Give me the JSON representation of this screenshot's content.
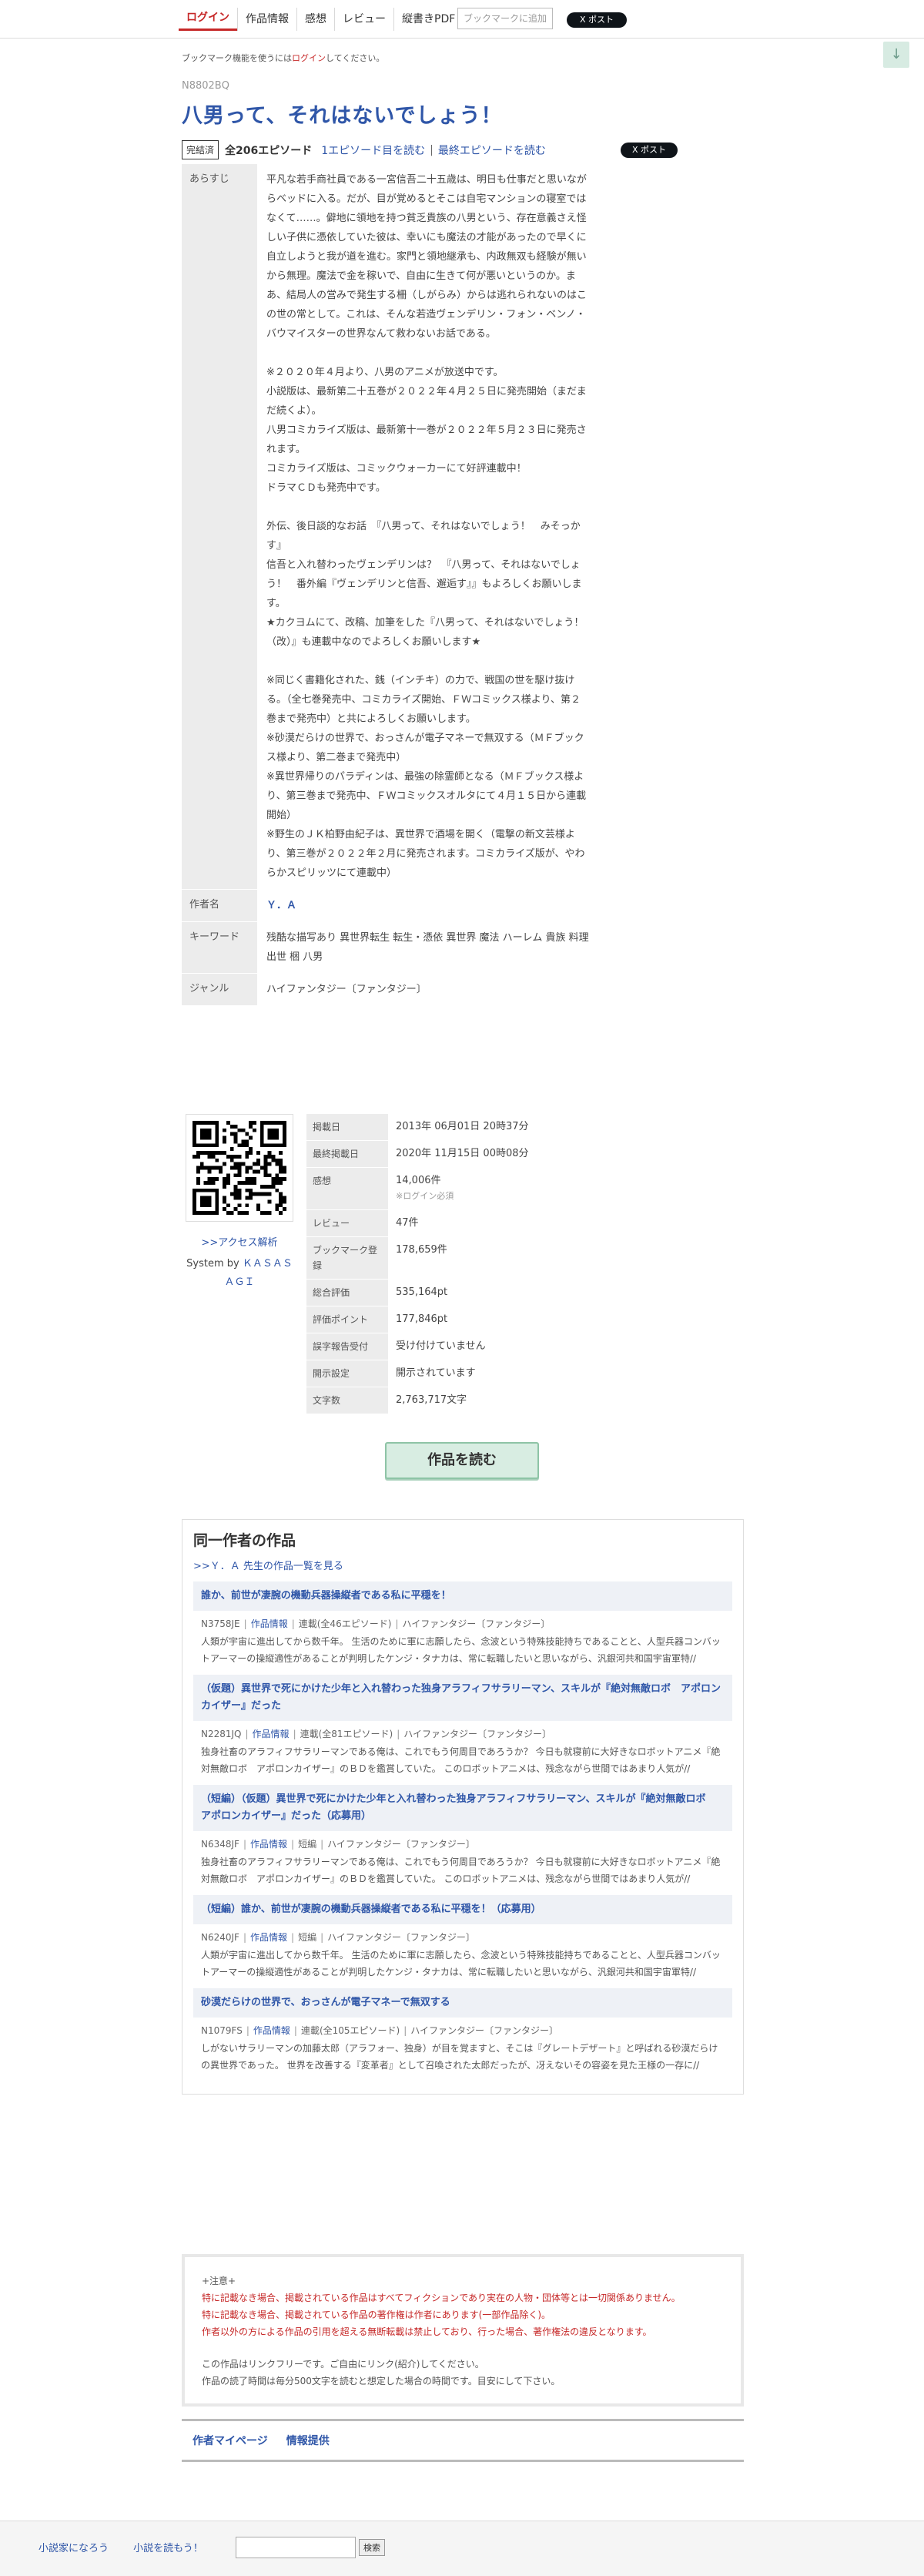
{
  "nav": {
    "items": [
      "ログイン",
      "作品情報",
      "感想",
      "レビュー",
      "縦書きPDF"
    ],
    "bookmark_button": "ブックマークに追加",
    "x_post": "X ポスト"
  },
  "login_note": {
    "prefix": "ブックマーク機能を使うには",
    "link": "ログイン",
    "suffix": "してください。"
  },
  "scroll_icon": "arrow-down-icon",
  "novel": {
    "ncode": "N8802BQ",
    "title": "八男って、それはないでしょう！",
    "status_badge": "完結済",
    "episodes": "全206エピソード",
    "first_episode_link": "1エピソード目を読む",
    "separator": "|",
    "last_episode_link": "最終エピソードを読む",
    "x_post": "X ポスト"
  },
  "info": {
    "synopsis_label": "あらすじ",
    "synopsis_lines": [
      "平凡な若手商社員である一宮信吾二十五歳は、明日も仕事だと思いながらベッドに入る。だが、目が覚めるとそこは自宅マンションの寝室ではなくて……。僻地に領地を持つ貧乏貴族の八男という、存在意義さえ怪しい子供に憑依していた彼は、幸いにも魔法の才能があったので早くに自立しようと我が道を進む。家門と領地継承も、内政無双も経験が無いから無理。魔法で金を稼いで、自由に生きて何が悪いというのか。まあ、結局人の営みで発生する柵（しがらみ）からは逃れられないのはこの世の常として。これは、そんな若造ヴェンデリン・フォン・ベンノ・バウマイスターの世界なんて救わないお話である。",
      "",
      "※２０２０年４月より、八男のアニメが放送中です。",
      "小説版は、最新第二十五巻が２０２２年４月２５日に発売開始（まだまだ続くよ）。",
      "八男コミカライズ版は、最新第十一巻が２０２２年５月２３日に発売されます。",
      "コミカライズ版は、コミックウォーカーにて好評連載中！",
      "ドラマＣＤも発売中です。",
      "",
      "外伝、後日談的なお話　『八男って、それはないでしょう！　みそっかす』",
      "信吾と入れ替わったヴェンデリンは？　『八男って、それはないでしょう！　番外編『ヴェンデリンと信吾、邂逅す』』もよろしくお願いします。",
      "★カクヨムにて、改稿、加筆をした『八男って、それはないでしょう！（改）』も連載中なのでよろしくお願いします★",
      "",
      "※同じく書籍化された、銭（インチキ）の力で、戦国の世を駆け抜ける。（全七巻発売中、コミカライズ開始、ＦＷコミックス様より、第２巻まで発売中）と共によろしくお願いします。",
      "※砂漠だらけの世界で、おっさんが電子マネーで無双する（ＭＦブックス様より、第二巻まで発売中）",
      "※異世界帰りのパラディンは、最強の除霊師となる（ＭＦブックス様より、第三巻まで発売中、ＦＷコミックスオルタにて４月１５日から連載開始）",
      "※野生のＪＫ柏野由紀子は、異世界で酒場を開く（電撃の新文芸様より、第三巻が２０２２年２月に発売されます。コミカライズ版が、やわらかスピリッツにて連載中）"
    ],
    "author_label": "作者名",
    "author": "Ｙ．Ａ",
    "keyword_label": "キーワード",
    "keywords": "残酷な描写あり 異世界転生 転生・憑依 異世界 魔法 ハーレム 貴族 料理 出世 梱 八男",
    "genre_label": "ジャンル",
    "genre": "ハイファンタジー〔ファンタジー〕"
  },
  "qr": {
    "access_link": ">>アクセス解析",
    "system_prefix": "System by ",
    "system_name": "ＫＡＳＡＳＡＧＩ"
  },
  "stats": [
    {
      "label": "掲載日",
      "value": "2013年 06月01日 20時37分"
    },
    {
      "label": "最終掲載日",
      "value": "2020年 11月15日 00時08分"
    },
    {
      "label": "感想",
      "value": "14,006件",
      "note": "※ログイン必須"
    },
    {
      "label": "レビュー",
      "value": "47件"
    },
    {
      "label": "ブックマーク登録",
      "value": "178,659件"
    },
    {
      "label": "総合評価",
      "value": "535,164pt"
    },
    {
      "label": "評価ポイント",
      "value": "177,846pt"
    },
    {
      "label": "誤字報告受付",
      "value": "受け付けていません"
    },
    {
      "label": "開示設定",
      "value": "開示されています"
    },
    {
      "label": "文字数",
      "value": "2,763,717文字"
    }
  ],
  "read_button": "作品を読む",
  "same_author": {
    "heading": "同一作者の作品",
    "all_link": ">>Ｙ．Ａ 先生の作品一覧を見る",
    "works": [
      {
        "title": "誰か、前世が凄腕の機動兵器操縦者である私に平穏を！",
        "ncode": "N3758JE",
        "info_link": "作品情報",
        "type": "連載(全46エピソード)",
        "genre": "ハイファンタジー〔ファンタジー〕",
        "desc": "人類が宇宙に進出してから数千年。 生活のために軍に志願したら、念波という特殊技能持ちであることと、人型兵器コンバットアーマーの操縦適性があることが判明したケンジ・タナカは、常に転職したいと思いながら、汎銀河共和国宇宙軍特//"
      },
      {
        "title": "（仮題）異世界で死にかけた少年と入れ替わった独身アラフィフサラリーマン、スキルが『絶対無敵ロボ　アポロンカイザー』だった",
        "ncode": "N2281JQ",
        "info_link": "作品情報",
        "type": "連載(全81エピソード)",
        "genre": "ハイファンタジー〔ファンタジー〕",
        "desc": "独身社畜のアラフィフサラリーマンである俺は、これでもう何周目であろうか？ 今日も就寝前に大好きなロボットアニメ『絶対無敵ロボ　アポロンカイザー』のＢＤを鑑賞していた。 このロボットアニメは、残念ながら世間ではあまり人気が//"
      },
      {
        "title": "（短編）（仮題）異世界で死にかけた少年と入れ替わった独身アラフィフサラリーマン、スキルが『絶対無敵ロボ　アポロンカイザー』だった（応募用）",
        "ncode": "N6348JF",
        "info_link": "作品情報",
        "type": "短編",
        "genre": "ハイファンタジー〔ファンタジー〕",
        "desc": "独身社畜のアラフィフサラリーマンである俺は、これでもう何周目であろうか？ 今日も就寝前に大好きなロボットアニメ『絶対無敵ロボ　アポロンカイザー』のＢＤを鑑賞していた。 このロボットアニメは、残念ながら世間ではあまり人気が//"
      },
      {
        "title": "（短編）誰か、前世が凄腕の機動兵器操縦者である私に平穏を！（応募用）",
        "ncode": "N6240JF",
        "info_link": "作品情報",
        "type": "短編",
        "genre": "ハイファンタジー〔ファンタジー〕",
        "desc": "人類が宇宙に進出してから数千年。 生活のために軍に志願したら、念波という特殊技能持ちであることと、人型兵器コンバットアーマーの操縦適性があることが判明したケンジ・タナカは、常に転職したいと思いながら、汎銀河共和国宇宙軍特//"
      },
      {
        "title": "砂漠だらけの世界で、おっさんが電子マネーで無双する",
        "ncode": "N1079FS",
        "info_link": "作品情報",
        "type": "連載(全105エピソード)",
        "genre": "ハイファンタジー〔ファンタジー〕",
        "desc": "しがないサラリーマンの加藤太郎（アラフォー、独身）が目を覚ますと、そこは『グレートデザート』と呼ばれる砂漠だらけの異世界であった。 世界を改善する『変革者』として召喚された太郎だったが、冴えないその容姿を見た王様の一存に//"
      }
    ]
  },
  "disclaimer": {
    "head": "+注意+",
    "red_lines": [
      "特に記載なき場合、掲載されている作品はすべてフィクションであり実在の人物・団体等とは一切関係ありません。",
      "特に記載なき場合、掲載されている作品の著作権は作者にあります(一部作品除く)。",
      "作者以外の方による作品の引用を超える無断転載は禁止しており、行った場合、著作権法の違反となります。"
    ],
    "grey_lines": [
      "この作品はリンクフリーです。ご自由にリンク(紹介)してください。",
      "作品の読了時間は毎分500文字を読むと想定した場合の時間です。目安にして下さい。"
    ]
  },
  "footer_links": [
    "作者マイページ",
    "情報提供"
  ],
  "footer": {
    "links": [
      "小説家になろう",
      "小説を読もう！"
    ],
    "search_button": "検索"
  }
}
